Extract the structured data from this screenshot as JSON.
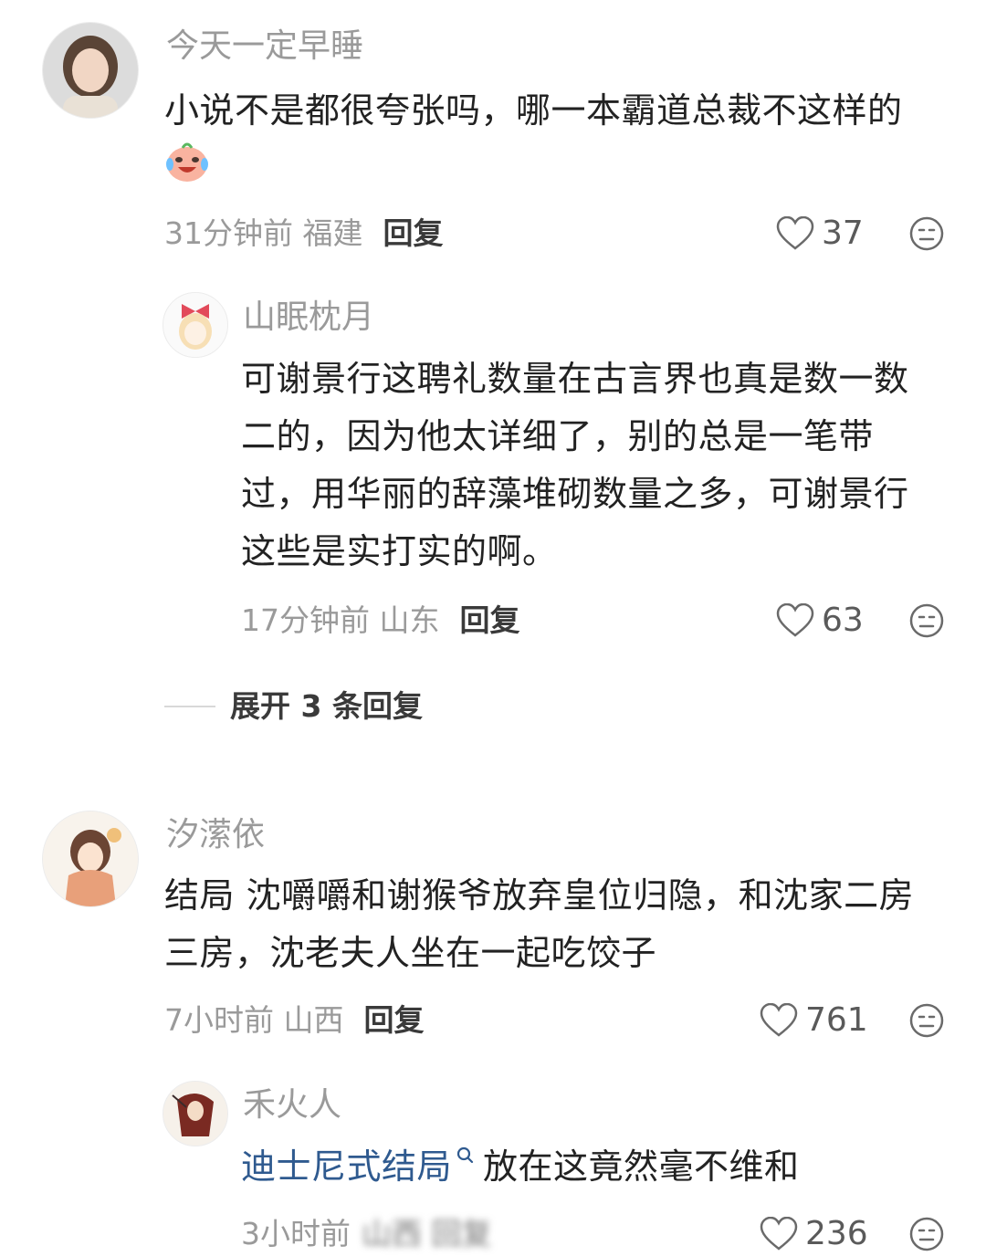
{
  "comments": [
    {
      "username": "今天一定早睡",
      "text_line1": "小说不是都很夸张吗，哪一本霸道总裁不这样的",
      "emoji": "crying-laughing-face",
      "time_location": "31分钟前 福建",
      "reply_label": "回复",
      "likes": "37"
    },
    {
      "username": "山眠枕月",
      "text_lines": [
        "可谢景行这聘礼数量在古言界也真是数一数",
        "二的，因为他太详细了，别的总是一笔带",
        "过，用华丽的辞藻堆砌数量之多，可谢景行",
        "这些是实打实的啊。"
      ],
      "time_location": "17分钟前 山东",
      "reply_label": "回复",
      "likes": "63"
    },
    {
      "username": "汐潆依",
      "text_lines": [
        "结局 沈嚼嚼和谢猴爷放弃皇位归隐，和沈家二房",
        "三房，沈老夫人坐在一起吃饺子"
      ],
      "time_location": "7小时前 山西",
      "reply_label": "回复",
      "likes": "761"
    },
    {
      "username": "禾火人",
      "link_text": "迪士尼式结局",
      "text_rest": "放在这竟然毫不维和",
      "time_location": "3小时前",
      "blurred_text": "山西 回复",
      "likes": "236"
    }
  ],
  "expand_replies": "展开 3 条回复",
  "colors": {
    "username": "#9a9a9a",
    "text": "#222222",
    "link": "#2f5a8f",
    "meta": "#9a9a9a"
  }
}
